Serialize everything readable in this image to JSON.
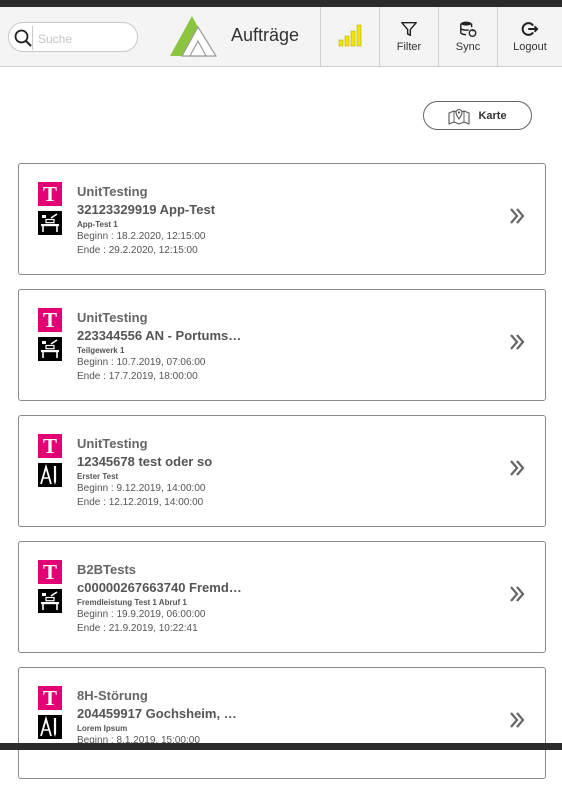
{
  "header": {
    "title": "Aufträge",
    "search_placeholder": "Suche",
    "buttons": {
      "filter": "Filter",
      "sync": "Sync",
      "logout": "Logout"
    }
  },
  "map_button_label": "Karte",
  "colors": {
    "telekom_magenta": "#e20074",
    "signal_yellow": "#f1e600",
    "logo_green": "#8cc63f"
  },
  "orders": [
    {
      "org": "UnitTesting",
      "title": "32123329919 App-Test",
      "subtitle": "App-Test 1",
      "start": "Beginn : 18.2.2020, 12:15:00",
      "end": "Ende : 29.2.2020, 12:15:00",
      "icon": "workbench-icon"
    },
    {
      "org": "UnitTesting",
      "title": "223344556 AN - Portums…",
      "subtitle": "Teilgewerk 1",
      "start": "Beginn : 10.7.2019, 07:06:00",
      "end": "Ende : 17.7.2019, 18:00:00",
      "icon": "workbench-icon"
    },
    {
      "org": "UnitTesting",
      "title": "12345678 test oder so",
      "subtitle": "Erster Test",
      "start": "Beginn : 9.12.2019, 14:00:00",
      "end": "Ende : 12.12.2019, 14:00:00",
      "icon": "drafting-tools-icon"
    },
    {
      "org": "B2BTests",
      "title": "c00000267663740 Fremd…",
      "subtitle": "Fremdleistung Test 1 Abruf 1",
      "start": "Beginn : 19.9.2019, 06:00:00",
      "end": "Ende : 21.9.2019, 10:22:41",
      "icon": "workbench-icon"
    },
    {
      "org": "8H-Störung",
      "title": "204459917 Gochsheim, …",
      "subtitle": "Lorem Ipsum",
      "start": "Beginn : 8.1.2019, 15:00:00",
      "end": "",
      "icon": "drafting-tools-icon"
    }
  ]
}
